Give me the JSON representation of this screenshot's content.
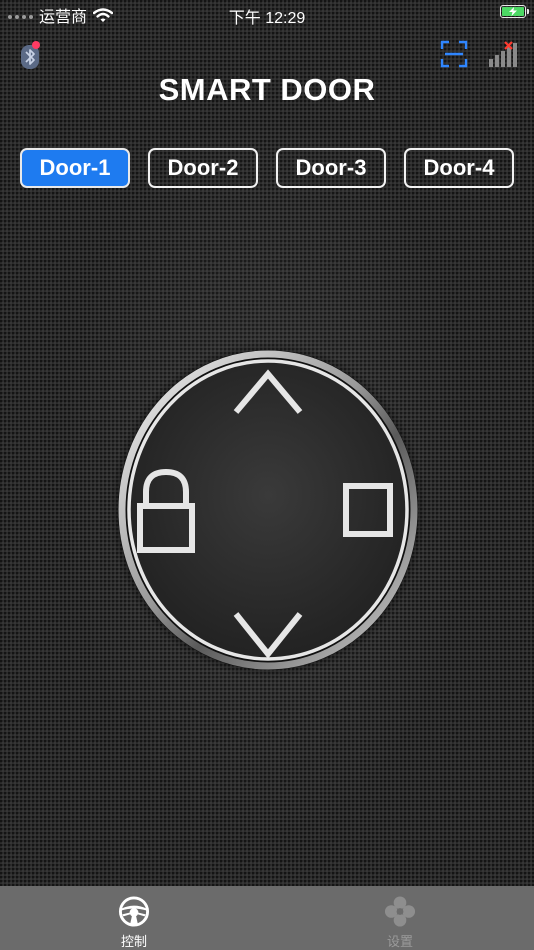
{
  "status_bar": {
    "carrier": "运营商",
    "time": "下午 12:29"
  },
  "header": {
    "title": "SMART DOOR"
  },
  "doors": {
    "tabs": [
      {
        "label": "Door-1",
        "selected": true
      },
      {
        "label": "Door-2",
        "selected": false
      },
      {
        "label": "Door-3",
        "selected": false
      },
      {
        "label": "Door-4",
        "selected": false
      }
    ]
  },
  "control_pad": {
    "buttons": [
      "up-icon",
      "lock-icon",
      "stop-icon",
      "down-icon"
    ]
  },
  "tab_bar": {
    "control_label": "控制",
    "settings_label": "设置"
  },
  "colors": {
    "accent": "#1e7bf0",
    "bluetooth_alert": "#ff3b63",
    "signal_alert": "#ff3b30",
    "battery": "#4cd964",
    "tab_bar": "#6b6b6b"
  }
}
